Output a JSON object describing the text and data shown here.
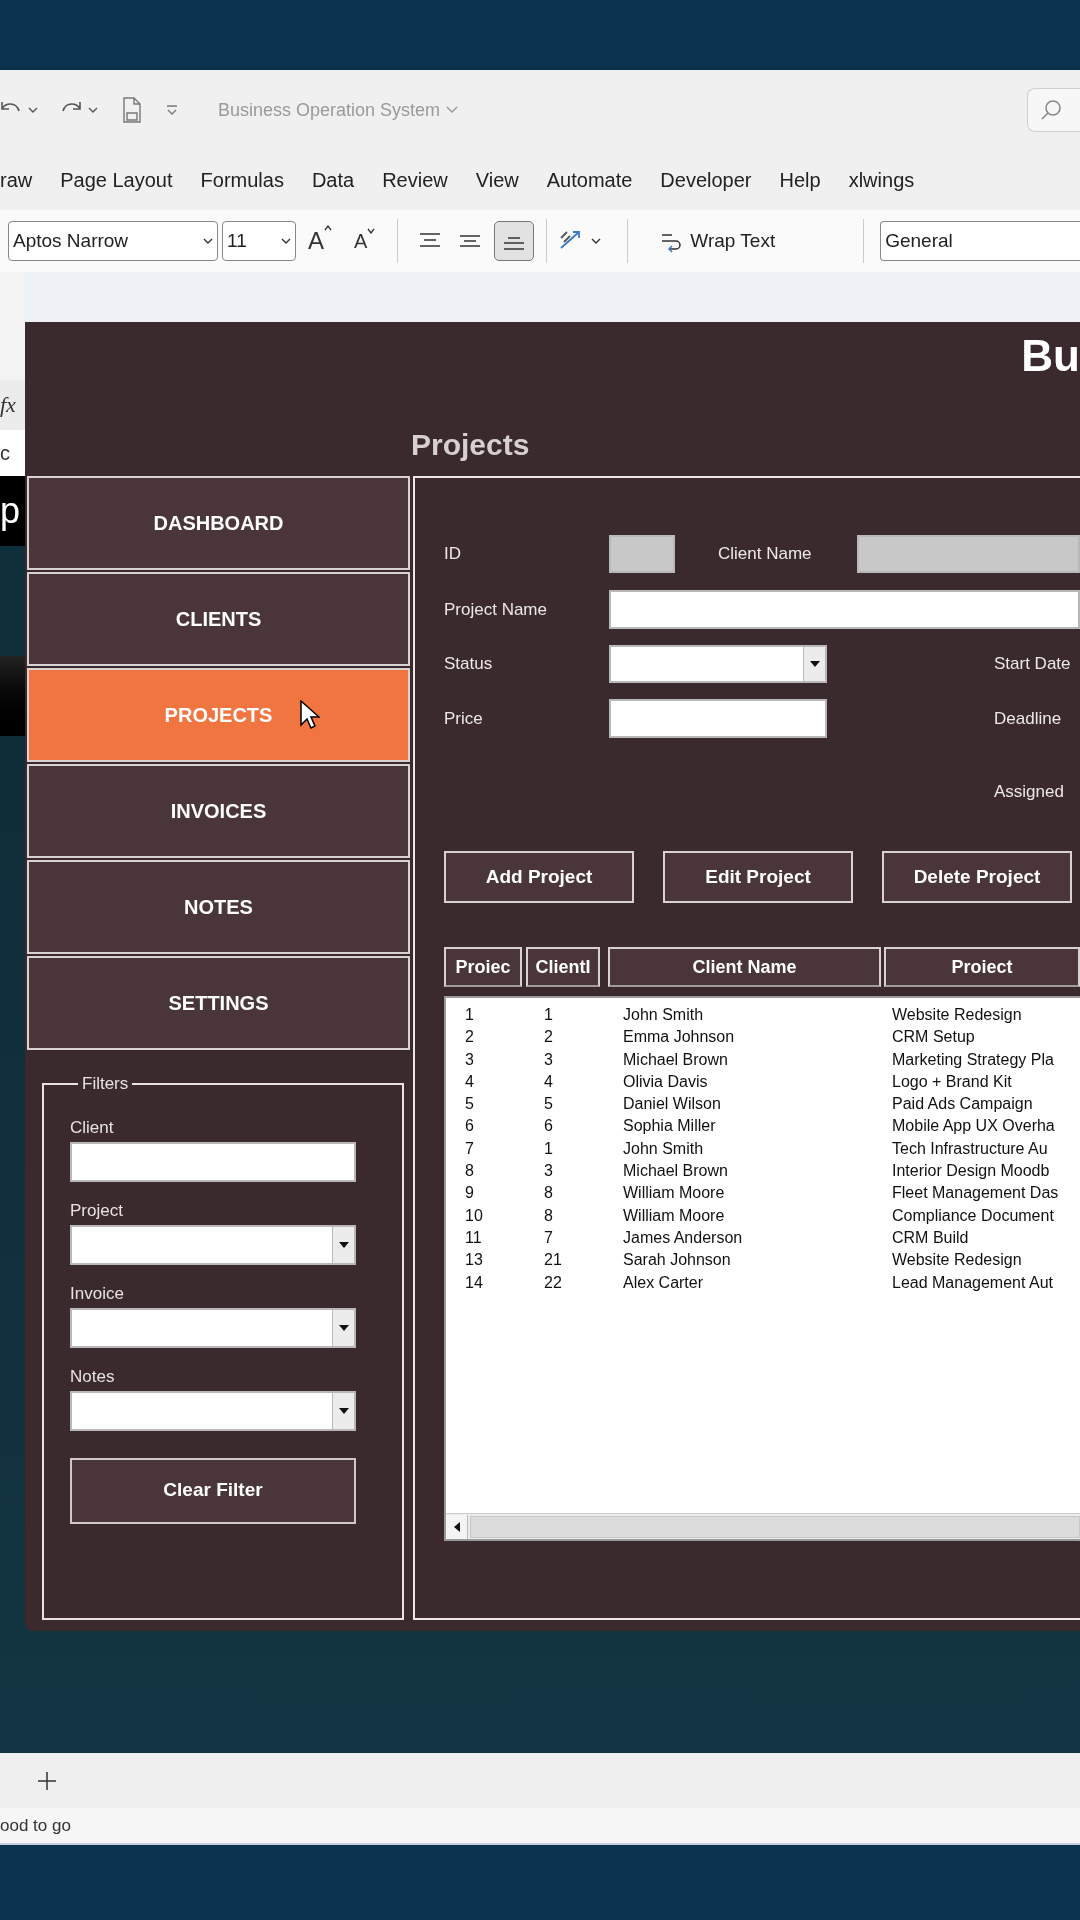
{
  "excel": {
    "title": "Business Operation System",
    "menu": [
      "raw",
      "Page Layout",
      "Formulas",
      "Data",
      "Review",
      "View",
      "Automate",
      "Developer",
      "Help",
      "xlwings"
    ],
    "font": "Aptos Narrow",
    "font_size": "11",
    "grow_font": "A",
    "shrink_font": "A",
    "wrap_text": "Wrap Text",
    "number_format": "General",
    "sheet_fragments": [
      "fx",
      "c",
      "p"
    ],
    "status": "ood to go"
  },
  "form": {
    "title": "Bu",
    "section": "Projects",
    "nav": [
      {
        "label": "DASHBOARD",
        "selected": false
      },
      {
        "label": "CLIENTS",
        "selected": false
      },
      {
        "label": "PROJECTS",
        "selected": true
      },
      {
        "label": "INVOICES",
        "selected": false
      },
      {
        "label": "NOTES",
        "selected": false
      },
      {
        "label": "SETTINGS",
        "selected": false
      }
    ],
    "filters": {
      "title": "Filters",
      "fields": [
        {
          "label": "Client",
          "kind": "text"
        },
        {
          "label": "Project",
          "kind": "dropdown"
        },
        {
          "label": "Invoice",
          "kind": "dropdown"
        },
        {
          "label": "Notes",
          "kind": "dropdown"
        }
      ],
      "clear": "Clear Filter"
    },
    "fields": [
      {
        "label": "ID",
        "kind": "text",
        "disabled": true
      },
      {
        "label": "Client Name",
        "kind": "text",
        "disabled": true
      },
      {
        "label": "Project Name",
        "kind": "text",
        "disabled": false
      },
      {
        "label": "Status",
        "kind": "dropdown",
        "disabled": false
      },
      {
        "label": "Price",
        "kind": "text",
        "disabled": false
      }
    ],
    "side_labels": [
      "Start Date",
      "Deadline",
      "Assigned"
    ],
    "buttons": [
      "Add Project",
      "Edit Project",
      "Delete Project"
    ],
    "table": {
      "columns": [
        "Proiec",
        "ClientI",
        "Client Name",
        "Proiect"
      ],
      "rows": [
        [
          "1",
          "1",
          "John Smith",
          "Website Redesign"
        ],
        [
          "2",
          "2",
          "Emma Johnson",
          "CRM Setup"
        ],
        [
          "3",
          "3",
          "Michael Brown",
          "Marketing Strategy Pla"
        ],
        [
          "4",
          "4",
          "Olivia Davis",
          "Logo + Brand Kit"
        ],
        [
          "5",
          "5",
          "Daniel Wilson",
          "Paid Ads Campaign"
        ],
        [
          "6",
          "6",
          "Sophia Miller",
          "Mobile App UX Overha"
        ],
        [
          "7",
          "1",
          "John Smith",
          "Tech Infrastructure Au"
        ],
        [
          "8",
          "3",
          "Michael Brown",
          "Interior Design Moodb"
        ],
        [
          "9",
          "8",
          "William Moore",
          "Fleet Management Das"
        ],
        [
          "10",
          "8",
          "William Moore",
          "Compliance Document"
        ],
        [
          "11",
          "7",
          "James Anderson",
          "CRM Build"
        ],
        [
          "13",
          "21",
          "Sarah Johnson",
          "Website Redesign"
        ],
        [
          "14",
          "22",
          "Alex Carter",
          "Lead Management Aut"
        ]
      ]
    }
  }
}
